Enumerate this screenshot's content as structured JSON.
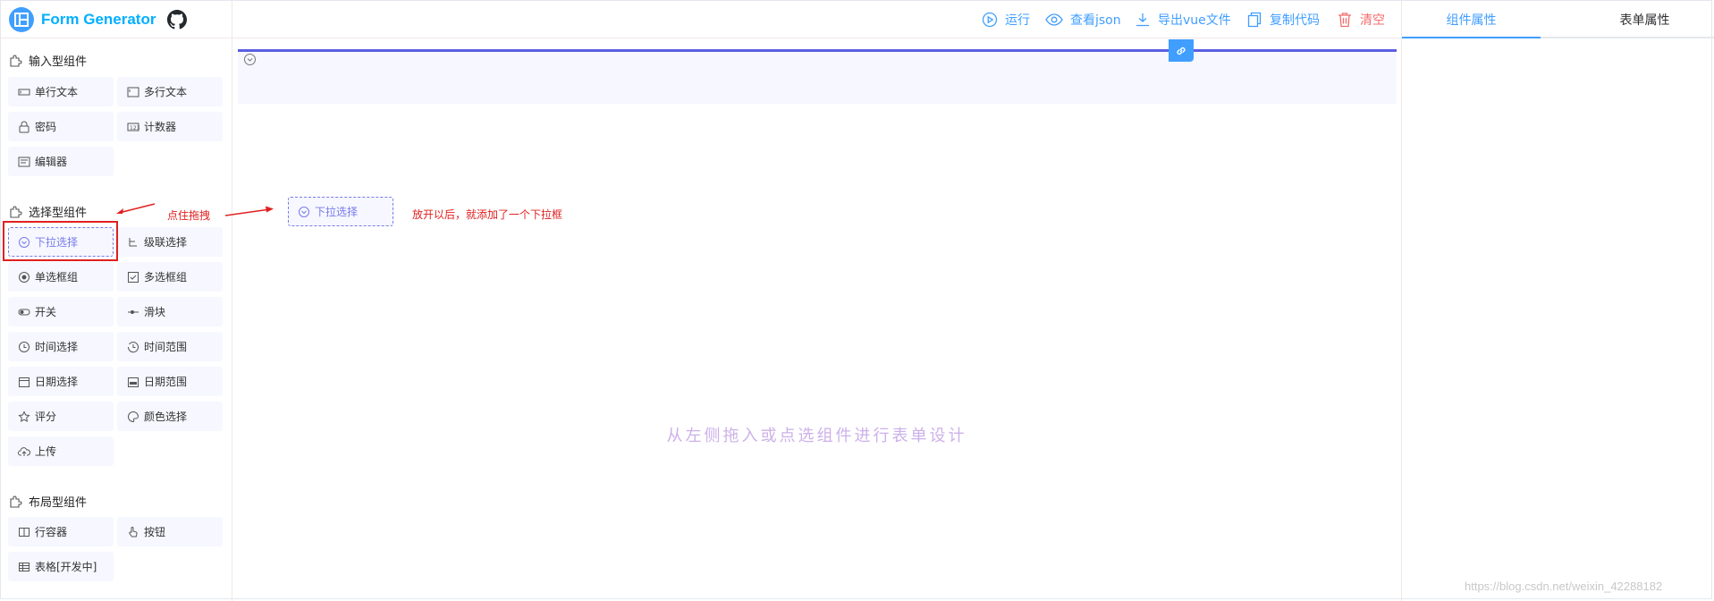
{
  "app": {
    "title": "Form Generator"
  },
  "sidebar": {
    "groups": [
      {
        "title": "输入型组件",
        "items": [
          "单行文本",
          "多行文本",
          "密码",
          "计数器",
          "编辑器"
        ]
      },
      {
        "title": "选择型组件",
        "items": [
          "下拉选择",
          "级联选择",
          "单选框组",
          "多选框组",
          "开关",
          "滑块",
          "时间选择",
          "时间范围",
          "日期选择",
          "日期范围",
          "评分",
          "颜色选择",
          "上传"
        ]
      },
      {
        "title": "布局型组件",
        "items": [
          "行容器",
          "按钮",
          "表格[开发中]"
        ]
      }
    ]
  },
  "toolbar": {
    "run": "运行",
    "view_json": "查看json",
    "export_vue": "导出vue文件",
    "copy_code": "复制代码",
    "clear": "清空"
  },
  "canvas": {
    "empty_info": "从左侧拖入或点选组件进行表单设计",
    "dragged_item": "下拉选择"
  },
  "annotations": {
    "drag_hint": "点住拖拽",
    "drop_hint": "放开以后，就添加了一个下拉框"
  },
  "right_panel": {
    "tabs": [
      "组件属性",
      "表单属性"
    ],
    "active_tab": "组件属性"
  },
  "watermark": "https://blog.csdn.net/weixin_42288182",
  "colors": {
    "accent": "#409eff",
    "danger": "#f56c6c",
    "annotation": "#e02020",
    "drag_border": "#787be8",
    "row_border": "#5b5fe0",
    "placeholder_text": "#ccb1ea"
  }
}
